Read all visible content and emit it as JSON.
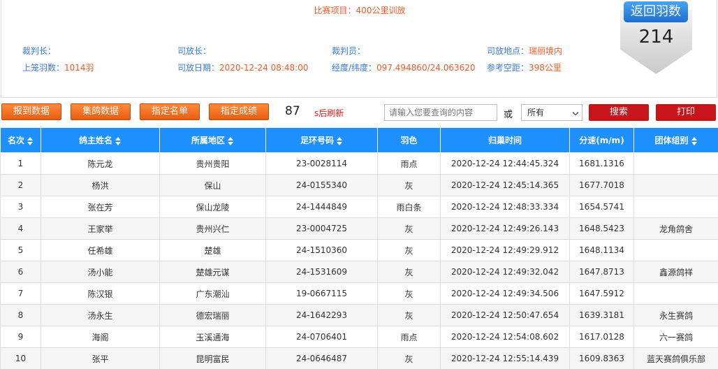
{
  "header": {
    "race_item_label": "比赛项目：",
    "race_item_value": "400公里训放",
    "chief_judge_label": "裁判长：",
    "chief_judge_value": "",
    "release_director_label": "司放长：",
    "release_director_value": "",
    "referee_label": "裁判员：",
    "referee_value": "",
    "release_place_label": "司放地点：",
    "release_place_value": "瑞丽境内",
    "caged_count_label": "上笼羽数：",
    "caged_count_value": "1014羽",
    "release_date_label": "司放日期：",
    "release_date_value": "2020-12-24 08:48:00",
    "coords_label": "经度/纬度：",
    "coords_value": "097.494860/24.063620",
    "ref_distance_label": "参考空距：",
    "ref_distance_value": "398公里"
  },
  "badge": {
    "title": "返回羽数",
    "count": "214"
  },
  "toolbar": {
    "buttons": [
      "报到数据",
      "集鸽数据",
      "指定名单",
      "指定成绩"
    ],
    "countdown": "87",
    "refresh_label": "s后刷新",
    "search_placeholder": "请输入您要查询的内容",
    "or_label": "或",
    "filter_value": "所有",
    "search_label": "搜索",
    "print_label": "打印"
  },
  "table": {
    "columns": [
      "名次",
      "鸽主姓名",
      "所属地区",
      "足环号码",
      "羽色",
      "归巢时间",
      "分速(m/m)",
      "团体组别"
    ],
    "rows": [
      [
        "1",
        "陈元龙",
        "贵州贵阳",
        "23-0028114",
        "雨点",
        "2020-12-24 12:44:45.324",
        "1681.1316",
        ""
      ],
      [
        "2",
        "杨洪",
        "保山",
        "24-0155340",
        "灰",
        "2020-12-24 12:45:14.365",
        "1677.7018",
        ""
      ],
      [
        "3",
        "张在芳",
        "保山龙陵",
        "24-1444849",
        "雨白条",
        "2020-12-24 12:48:33.334",
        "1654.5741",
        ""
      ],
      [
        "4",
        "王家举",
        "贵州兴仁",
        "23-0004725",
        "灰",
        "2020-12-24 12:49:26.143",
        "1648.5423",
        "龙角鸽舍"
      ],
      [
        "5",
        "任希雄",
        "楚雄",
        "24-1510360",
        "灰",
        "2020-12-24 12:49:29.912",
        "1648.1134",
        ""
      ],
      [
        "6",
        "汤小能",
        "楚雄元谋",
        "24-1531609",
        "灰",
        "2020-12-24 12:49:32.042",
        "1647.8713",
        "鑫源鸽祥"
      ],
      [
        "7",
        "陈汉银",
        "广东潮汕",
        "19-0667115",
        "灰",
        "2020-12-24 12:49:34.506",
        "1647.5912",
        ""
      ],
      [
        "8",
        "汤永生",
        "德宏瑞丽",
        "24-1642293",
        "灰",
        "2020-12-24 12:50:47.654",
        "1639.3181",
        "永生赛鸽"
      ],
      [
        "9",
        "海阁",
        "玉溪通海",
        "24-0706401",
        "雨点",
        "2020-12-24 12:54:08.602",
        "1617.0128",
        "六一赛鸽"
      ],
      [
        "10",
        "张平",
        "昆明富民",
        "24-0646487",
        "灰",
        "2020-12-24 12:55:14.439",
        "1609.8363",
        "蓝天赛鸽俱乐部"
      ]
    ]
  },
  "colors": {
    "accent_blue": "#1e90ff",
    "orange": "#f05a28",
    "button_orange": "#ff8a3d",
    "button_red": "#c8151b",
    "label_blue": "#3a7bd5"
  }
}
